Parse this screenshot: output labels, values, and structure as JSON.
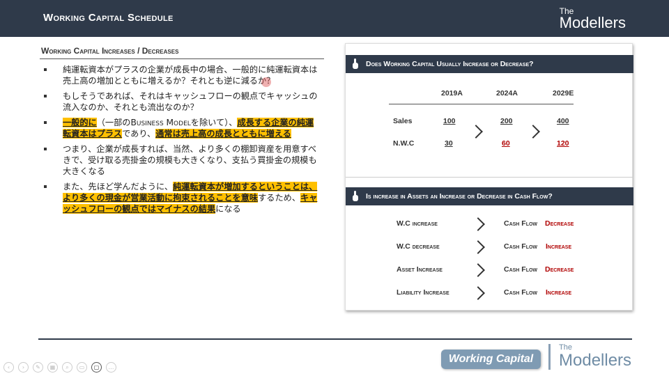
{
  "header": {
    "title": "Working Capital Schedule",
    "logo_the": "The",
    "logo_name": "Modellers"
  },
  "section": {
    "title": "Working Capital Increases / Decreases"
  },
  "bullets": [
    {
      "segments": [
        "純運転資本がプラスの企業が成長中の場合、一般的に純運転資本は売上高の増加とともに増えるか？それとも逆に減るか？"
      ]
    },
    {
      "segments": [
        "もしそうであれば、それはキャッシュフローの観点でキャッシュの流入なのか、それとも流出なのか？"
      ]
    },
    {
      "segments": [
        "一般的に",
        "（一部の",
        "Business Model",
        "を除いて）、",
        "成長する企業の純運転資本はプラス",
        "であり、",
        "通常は売上高の成長とともに増える"
      ]
    },
    {
      "segments": [
        "つまり、企業が成長すれば、当然、より多くの棚卸資産を用意すべきで、受け取る売掛金の規模も大きくなり、支払う買掛金の規模も大きくなる"
      ]
    },
    {
      "segments": [
        "また、先ほど学んだように、",
        "純運転資本が増加するということは、より多くの現金が営業活動に拘束されることを意味",
        "するため、",
        "キャッシュフローの観点ではマイナスの結果",
        "になる"
      ]
    }
  ],
  "panel1": {
    "title": "Does Working Capital Usually Increase or Decrease?",
    "columns": [
      "2019A",
      "2024A",
      "2029E"
    ],
    "rows": [
      {
        "label": "Sales",
        "values": [
          "100",
          "200",
          "400"
        ]
      },
      {
        "label": "N.W.C",
        "values": [
          "30",
          "60",
          "120"
        ]
      }
    ]
  },
  "panel2": {
    "title": "Is increase in Assets an Increase or Decrease in Cash Flow?",
    "rows": [
      {
        "label": "W.C increase",
        "cf": "Cash Flow",
        "result": "Decrease"
      },
      {
        "label": "W.C decrease",
        "cf": "Cash Flow",
        "result": "Increase"
      },
      {
        "label": "Asset Increase",
        "cf": "Cash Flow",
        "result": "Decrease"
      },
      {
        "label": "Liability Increase",
        "cf": "Cash Flow",
        "result": "Increase"
      }
    ]
  },
  "footer": {
    "badge": "Working Capital",
    "logo_the": "The",
    "logo_name": "Modellers"
  },
  "colors": {
    "header": "#2f3a4a",
    "highlight": "#ffc000",
    "red": "#b00000",
    "badge": "#7f9bb3"
  }
}
